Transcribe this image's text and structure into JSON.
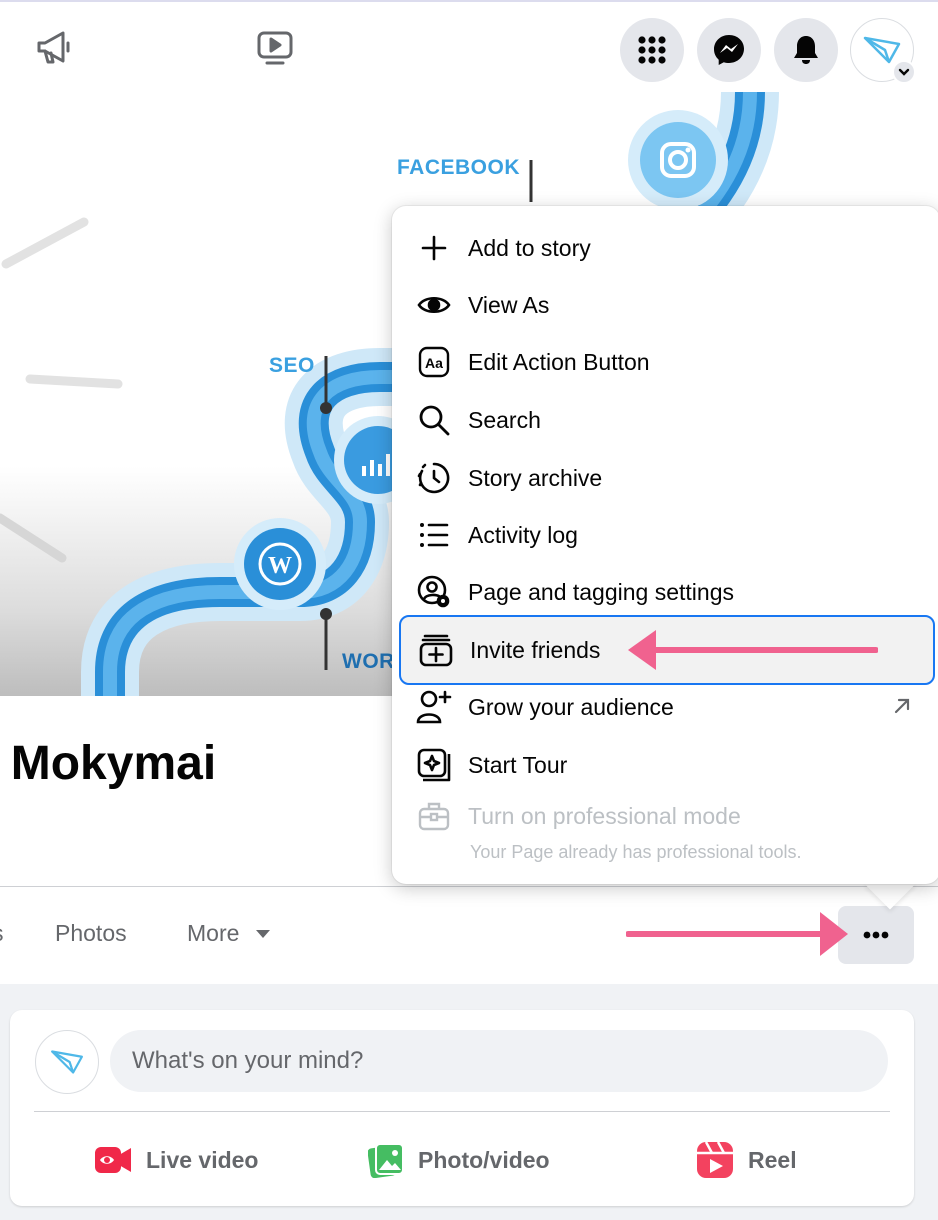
{
  "topbar": {
    "icons": [
      "megaphone-icon",
      "watch-video-icon",
      "apps-grid-icon",
      "messenger-icon",
      "notifications-bell-icon"
    ],
    "avatar_alt": "profile-avatar"
  },
  "cover": {
    "labels": {
      "facebook": "FACEBOOK",
      "seo": "SEO",
      "wordpress_partial": "WOR"
    }
  },
  "profile": {
    "page_name": "' Mokymai",
    "tabs": [
      {
        "label": "s"
      },
      {
        "label": "Photos"
      },
      {
        "label": "More"
      }
    ]
  },
  "menu": {
    "items": [
      {
        "label": "Add to story",
        "icon": "plus-icon"
      },
      {
        "label": "View As",
        "icon": "eye-icon"
      },
      {
        "label": "Edit Action Button",
        "icon": "aa-text-icon"
      },
      {
        "label": "Search",
        "icon": "search-icon"
      },
      {
        "label": "Story archive",
        "icon": "clock-archive-icon"
      },
      {
        "label": "Activity log",
        "icon": "list-icon"
      },
      {
        "label": "Page and tagging settings",
        "icon": "user-settings-icon"
      },
      {
        "label": "Invite friends",
        "icon": "invite-add-icon",
        "highlighted": true
      },
      {
        "label": "Grow your audience",
        "icon": "add-person-icon",
        "external": true
      },
      {
        "label": "Start Tour",
        "icon": "tour-icon"
      },
      {
        "label": "Turn on professional mode",
        "icon": "briefcase-icon",
        "disabled": true,
        "sublabel": "Your Page already has professional tools."
      }
    ]
  },
  "composer": {
    "placeholder": "What's on your mind?",
    "actions": [
      {
        "label": "Live video",
        "icon": "live-video-icon",
        "color": "#f02849"
      },
      {
        "label": "Photo/video",
        "icon": "photo-video-icon",
        "color": "#45bd62"
      },
      {
        "label": "Reel",
        "icon": "reel-icon",
        "color": "#f3425f"
      }
    ]
  },
  "colors": {
    "accent_blue": "#1877f2",
    "annotation_pink": "#f0628f"
  }
}
